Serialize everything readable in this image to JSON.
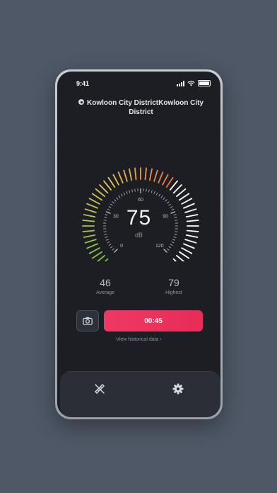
{
  "status": {
    "time": "9:41"
  },
  "location": {
    "text": "Kowloon City DistrictKowloon City District",
    "icon": "location-pin-icon"
  },
  "gauge": {
    "value": "75",
    "value_number": 75,
    "unit": "dB",
    "min": 0,
    "max": 120,
    "tick_labels": [
      "0",
      "30",
      "60",
      "90",
      "120"
    ],
    "colors": {
      "low": "#7cc04a",
      "mid": "#e6c65a",
      "high": "#e9573a",
      "inactive": "#ffffff"
    }
  },
  "stats": {
    "average_value": "46",
    "average_label": "Average",
    "highest_value": "79",
    "highest_label": "Highest"
  },
  "controls": {
    "camera_icon": "camera-icon",
    "timer_label": "00:45",
    "history_link": "View historical data"
  },
  "tabbar": {
    "measure_icon": "ruler-pencil-icon",
    "settings_icon": "gear-icon"
  },
  "theme": {
    "accent": "#ec3460",
    "background": "#1c1e23"
  }
}
